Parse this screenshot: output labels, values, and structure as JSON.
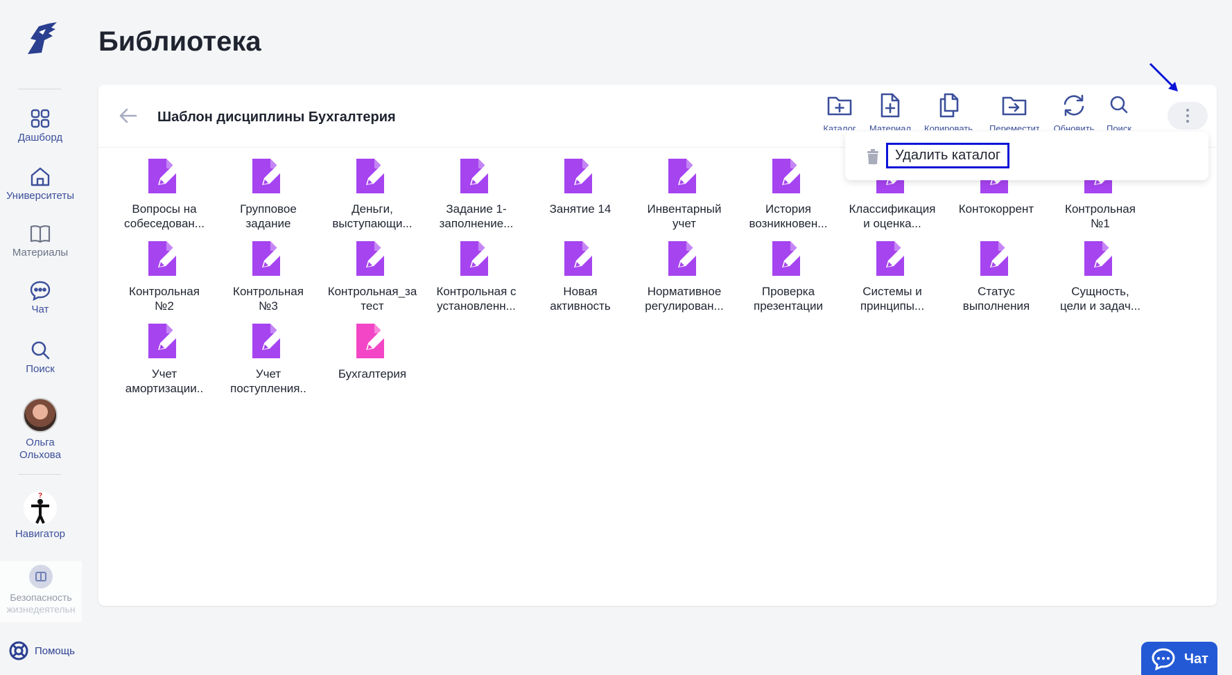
{
  "sidebar": {
    "items": [
      {
        "label": "Дашборд",
        "icon": "dashboard-icon"
      },
      {
        "label": "Университеты",
        "icon": "university-icon"
      },
      {
        "label": "Материалы",
        "icon": "book-icon"
      },
      {
        "label": "Чат",
        "icon": "chat-icon"
      },
      {
        "label": "Поиск",
        "icon": "search-icon"
      }
    ],
    "user": {
      "first": "Ольга",
      "last": "Ольхова"
    },
    "navigator": "Навигатор",
    "course": {
      "line1": "Безопасность",
      "line2": "жизнедеятельн"
    },
    "help": "Помощь"
  },
  "page": {
    "title": "Библиотека"
  },
  "folder": {
    "title": "Шаблон дисциплины Бухгалтерия"
  },
  "toolbar": [
    {
      "label": "Каталог",
      "icon": "folder-plus-icon"
    },
    {
      "label": "Материал",
      "icon": "file-plus-icon"
    },
    {
      "label": "Копировать",
      "icon": "copy-icon"
    },
    {
      "label": "Переместить",
      "icon": "folder-move-icon"
    },
    {
      "label": "Обновить",
      "icon": "refresh-icon"
    },
    {
      "label": "Поиск",
      "icon": "search-icon"
    }
  ],
  "dropdown": {
    "delete_label": "Удалить каталог"
  },
  "items": [
    {
      "name": "Вопросы на\nсобеседован..."
    },
    {
      "name": "Групповое\nзадание"
    },
    {
      "name": "Деньги,\nвыступающи..."
    },
    {
      "name": "Задание 1-\nзаполнение..."
    },
    {
      "name": "Занятие 14"
    },
    {
      "name": "Инвентарный\nучет"
    },
    {
      "name": "История\nвозникновен..."
    },
    {
      "name": "Классификация\nи оценка..."
    },
    {
      "name": "Контокоррент"
    },
    {
      "name": "Контрольная\n№1"
    },
    {
      "name": "Контрольная\n№2"
    },
    {
      "name": "Контрольная\n№3"
    },
    {
      "name": "Контрольная_за\nтест"
    },
    {
      "name": "Контрольная с\nустановленн..."
    },
    {
      "name": "Новая\nактивность"
    },
    {
      "name": "Нормативное\nрегулирован..."
    },
    {
      "name": "Проверка\nпрезентации"
    },
    {
      "name": "Системы и\nпринципы..."
    },
    {
      "name": "Статус\nвыполнения"
    },
    {
      "name": "Сущность,\nцели и задач..."
    },
    {
      "name": "Учет\nамортизации.."
    },
    {
      "name": "Учет\nпоступления.."
    },
    {
      "name": "Бухгалтерия"
    }
  ],
  "colors": {
    "accent": "#a644f0",
    "accent_alt": "#f346c6",
    "nav": "#3b4f9a",
    "highlight": "#0a14d6",
    "chat": "#2459d6"
  },
  "chat_button": {
    "label": "Чат"
  }
}
